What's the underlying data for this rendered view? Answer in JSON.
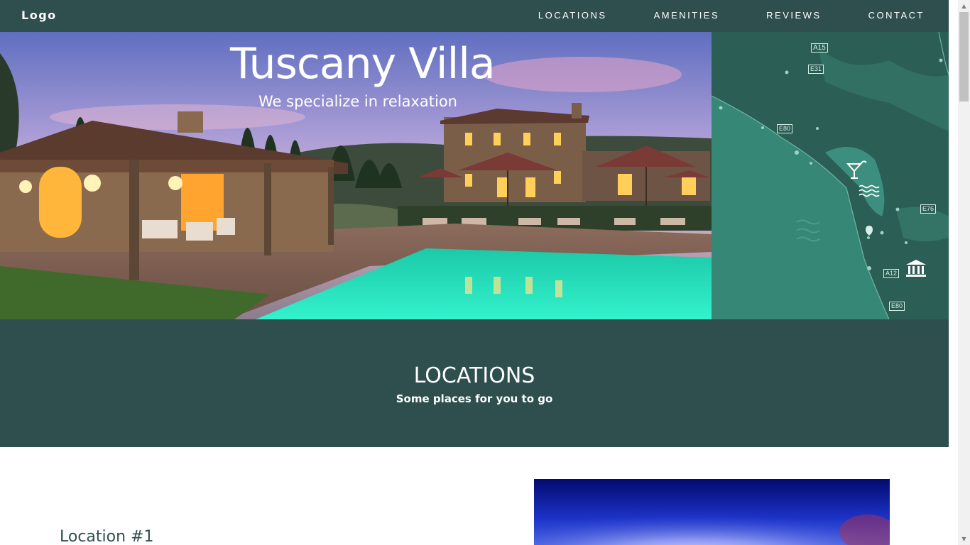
{
  "nav": {
    "logo": "Logo",
    "links": [
      "LOCATIONS",
      "AMENITIES",
      "REVIEWS",
      "CONTACT"
    ]
  },
  "hero": {
    "title": "Tuscany Villa",
    "subtitle": "We specialize in relaxation"
  },
  "map": {
    "roads": [
      "A15",
      "E31",
      "E80",
      "E76",
      "A12",
      "E80"
    ],
    "icons": [
      "cocktail-icon",
      "waves-icon",
      "pin-icon",
      "museum-icon"
    ]
  },
  "section": {
    "title": "LOCATIONS",
    "subtitle": "Some places for you to go"
  },
  "location": {
    "title": "Location #1"
  },
  "colors": {
    "primary": "#2f4f4f",
    "map_sea": "#357a6c",
    "map_land": "#2c5f55"
  }
}
